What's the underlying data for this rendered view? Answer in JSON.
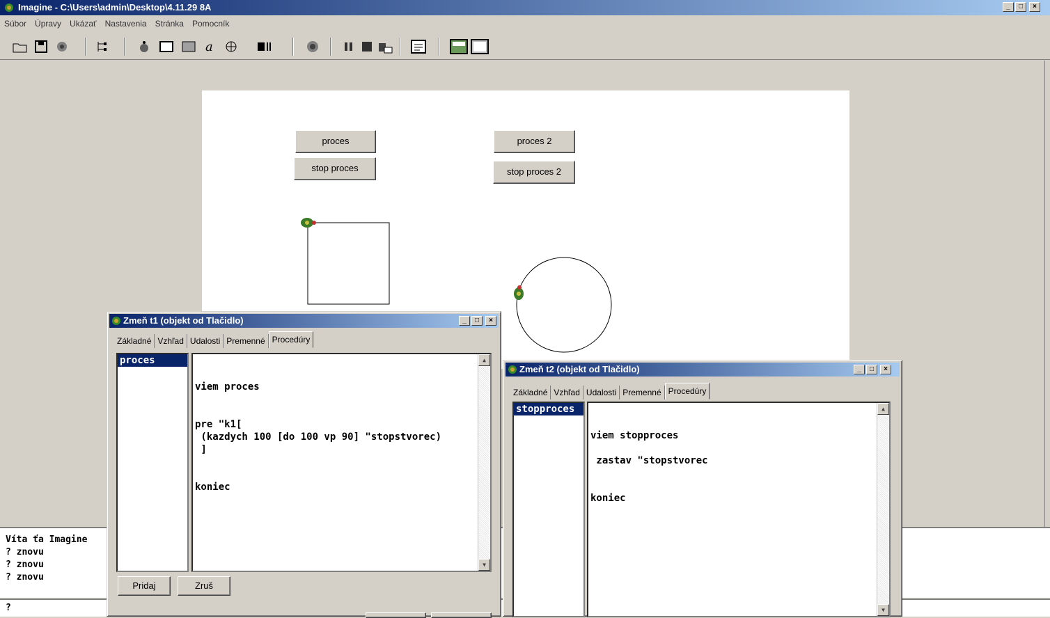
{
  "window": {
    "title": "Imagine - C:\\Users\\admin\\Desktop\\4.11.29 8A"
  },
  "menu": [
    "Súbor",
    "Úpravy",
    "Ukázať",
    "Nastavenia",
    "Stránka",
    "Pomocník"
  ],
  "page": {
    "buttons": {
      "proces": "proces",
      "stop_proces": "stop proces",
      "proces2": "proces 2",
      "stop_proces2": "stop proces 2"
    }
  },
  "console": {
    "lines": [
      "Víta ťa Imagine",
      "? znovu",
      "? znovu",
      "? znovu"
    ],
    "prompt": "?"
  },
  "dialog1": {
    "title": "Zmeň t1 (objekt od Tlačidlo)",
    "tabs": [
      "Základné",
      "Vzhľad",
      "Udalosti",
      "Premenné",
      "Procedúry"
    ],
    "selected_procedure": "proces",
    "code": "viem proces\n\n\npre \"k1[\n (kazdych 100 [do 100 vp 90] \"stopstvorec)\n ]\n\n\nkoniec",
    "add_button": "Pridaj",
    "cancel_button": "Zruš"
  },
  "dialog2": {
    "title": "Zmeň t2 (objekt od Tlačidlo)",
    "tabs": [
      "Základné",
      "Vzhľad",
      "Udalosti",
      "Premenné",
      "Procedúry"
    ],
    "selected_procedure": "stopproces",
    "code": "viem stopproces\n\n zastav \"stopstvorec\n\n\nkoniec"
  },
  "colors": {
    "titlebar": "#0a246a",
    "face": "#d4d0c8"
  }
}
